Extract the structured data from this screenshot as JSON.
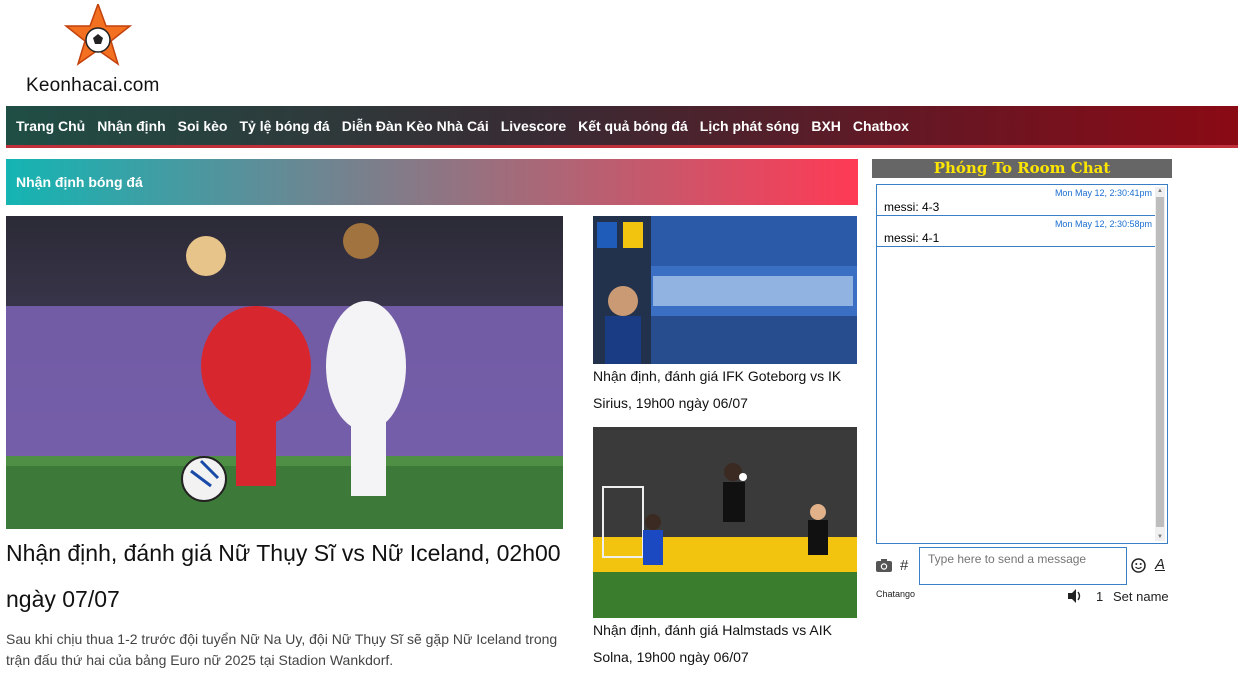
{
  "logo": {
    "text": "Keonhacai.com"
  },
  "nav": {
    "items": [
      "Trang Chủ",
      "Nhận định",
      "Soi kèo",
      "Tỷ lệ bóng đá",
      "Diễn Đàn Kèo Nhà Cái",
      "Livescore",
      "Kết quả bóng đá",
      "Lịch phát sóng",
      "BXH",
      "Chatbox"
    ]
  },
  "section": {
    "title": "Nhận định bóng đá"
  },
  "main_article": {
    "title": "Nhận định, đánh giá Nữ Thụy Sĩ vs Nữ Iceland, 02h00 ngày 07/07",
    "excerpt": "Sau khi chịu thua 1-2 trước đội tuyển Nữ Na Uy, đội Nữ Thụy Sĩ sẽ gặp Nữ Iceland trong trận đấu thứ hai của bảng Euro nữ 2025 tại Stadion Wankdorf."
  },
  "side_articles": [
    {
      "title": "Nhận định, đánh giá IFK Goteborg vs IK Sirius, 19h00 ngày 06/07"
    },
    {
      "title": "Nhận định, đánh giá Halmstads vs AIK Solna, 19h00 ngày 06/07"
    }
  ],
  "chat": {
    "header": "Phóng To Room Chat",
    "messages": [
      {
        "time": "Mon May 12, 2:30:41pm",
        "text": "messi: 4-3"
      },
      {
        "time": "Mon May 12, 2:30:58pm",
        "text": "messi: 4-1"
      }
    ],
    "input_placeholder": "Type here to send a message",
    "hash": "#",
    "format_label": "A",
    "brand": "Chatango",
    "user_count": "1",
    "set_name_label": "Set name"
  },
  "colors": {
    "nav_start": "#1f4e45",
    "nav_end": "#8a0a14",
    "section_start": "#14b5b3",
    "section_end": "#ff3a55",
    "chat_header_bg": "#666666",
    "chat_header_text": "#ffe600",
    "chat_border": "#3a7fc5"
  }
}
